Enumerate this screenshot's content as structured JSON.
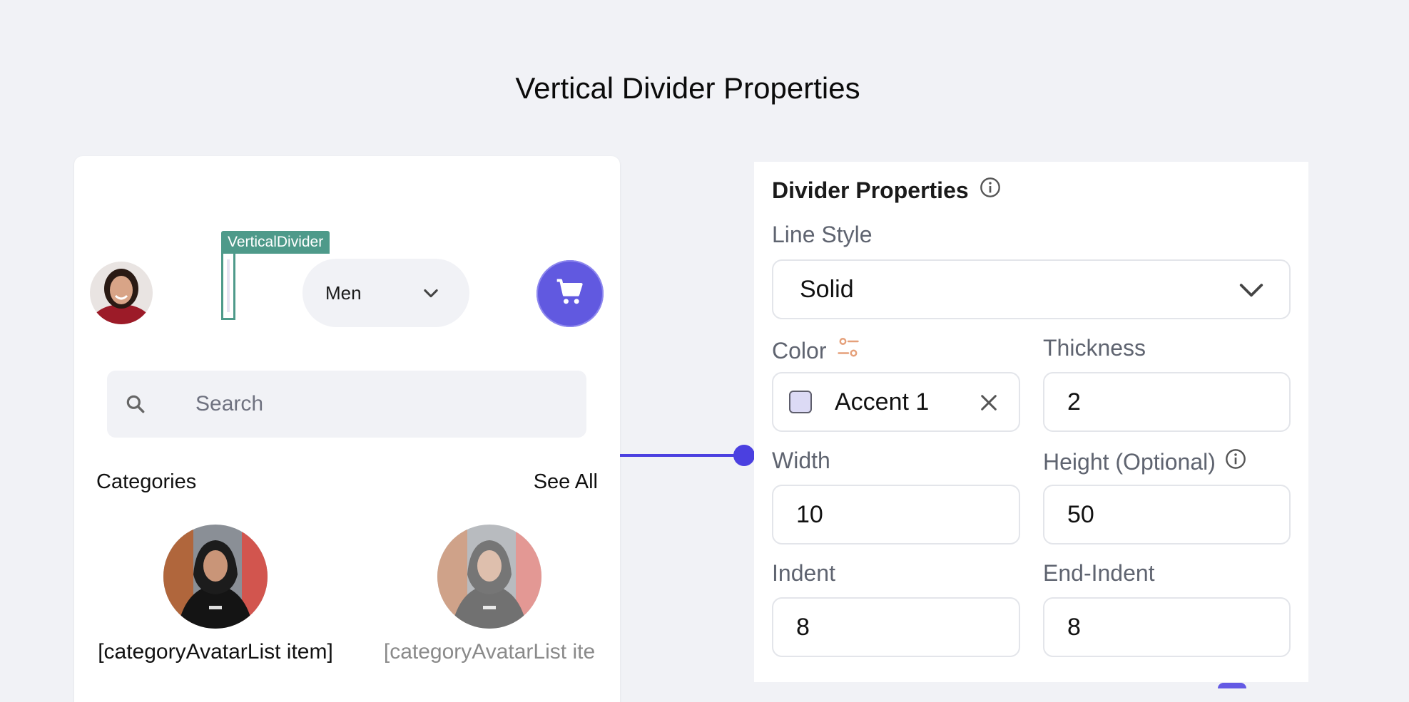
{
  "page": {
    "title": "Vertical Divider Properties"
  },
  "preview": {
    "vertical_divider_tag": "VerticalDivider",
    "gender_dropdown": {
      "value": "Men"
    },
    "search": {
      "placeholder": "Search"
    },
    "categories": {
      "title": "Categories",
      "see_all": "See All",
      "items": [
        {
          "label": "[categoryAvatarList item]"
        },
        {
          "label": "[categoryAvatarList ite"
        }
      ]
    }
  },
  "panel": {
    "title": "Divider Properties",
    "line_style": {
      "label": "Line Style",
      "value": "Solid"
    },
    "color": {
      "label": "Color",
      "value": "Accent 1",
      "swatch": "#dcdaf5"
    },
    "thickness": {
      "label": "Thickness",
      "value": "2"
    },
    "width": {
      "label": "Width",
      "value": "10"
    },
    "height": {
      "label": "Height (Optional)",
      "value": "50"
    },
    "indent": {
      "label": "Indent",
      "value": "8"
    },
    "end_indent": {
      "label": "End-Indent",
      "value": "8"
    }
  },
  "colors": {
    "accent": "#6159e0",
    "connector": "#4b40e0",
    "selection_tag": "#4e9a8a",
    "background": "#f1f2f6"
  },
  "icons": {
    "info": "info-circle-icon",
    "color_picker": "sliders-icon",
    "dropdown": "chevron-down-icon",
    "clear": "close-icon",
    "search": "search-icon",
    "cart": "shopping-cart-icon"
  }
}
